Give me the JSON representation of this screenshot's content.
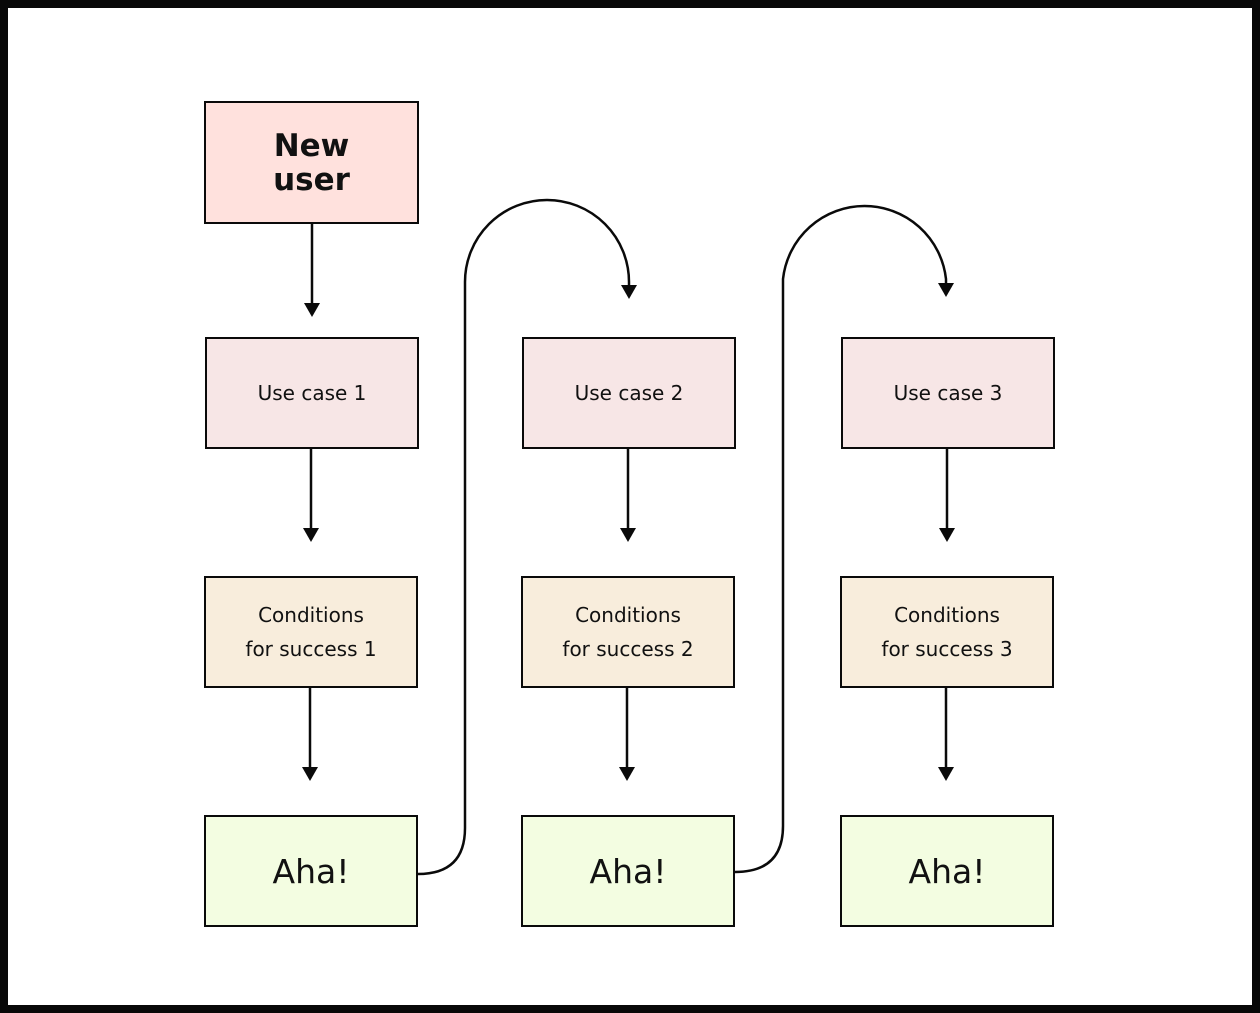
{
  "diagram": {
    "type": "flowchart",
    "start": {
      "label": "New user",
      "line1": "New",
      "line2": "user",
      "color": "#ffe1dd"
    },
    "columns": [
      {
        "use_case": "Use case 1",
        "conditions_line1": "Conditions",
        "conditions_line2": "for success 1",
        "aha": "Aha!"
      },
      {
        "use_case": "Use case 2",
        "conditions_line1": "Conditions",
        "conditions_line2": "for success 2",
        "aha": "Aha!"
      },
      {
        "use_case": "Use case 3",
        "conditions_line1": "Conditions",
        "conditions_line2": "for success 3",
        "aha": "Aha!"
      }
    ],
    "colors": {
      "use_case_fill": "#f7e6e6",
      "conditions_fill": "#f8eddc",
      "aha_fill": "#f3fde1",
      "stroke": "#0a0a0a"
    },
    "edges": [
      {
        "from": "New user",
        "to": "Use case 1"
      },
      {
        "from": "Use case 1",
        "to": "Conditions for success 1"
      },
      {
        "from": "Conditions for success 1",
        "to": "Aha! (1)"
      },
      {
        "from": "Aha! (1)",
        "to": "Use case 2"
      },
      {
        "from": "Use case 2",
        "to": "Conditions for success 2"
      },
      {
        "from": "Conditions for success 2",
        "to": "Aha! (2)"
      },
      {
        "from": "Aha! (2)",
        "to": "Use case 3"
      },
      {
        "from": "Use case 3",
        "to": "Conditions for success 3"
      },
      {
        "from": "Conditions for success 3",
        "to": "Aha! (3)"
      }
    ]
  }
}
